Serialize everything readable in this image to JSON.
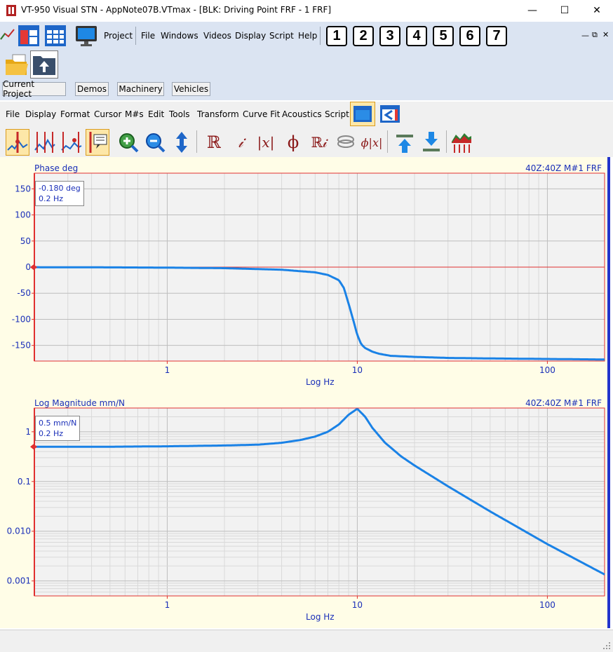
{
  "window": {
    "title": "VT-950 Visual STN - AppNote07B.VTmax - [BLK: Driving Point FRF - 1 FRF]",
    "controls": [
      "—",
      "☐",
      "✕"
    ]
  },
  "main_menu": {
    "items": [
      "Project",
      "File",
      "Windows",
      "Videos",
      "Display",
      "Script",
      "Help"
    ],
    "number_buttons": [
      "1",
      "2",
      "3",
      "4",
      "5",
      "6",
      "7"
    ]
  },
  "project_tabs": [
    "Current Project",
    "Demos",
    "Machinery",
    "Vehicles"
  ],
  "window_menu": [
    "File",
    "Display",
    "Format",
    "Cursor",
    "M#s",
    "Edit",
    "Tools",
    "Transform",
    "Curve Fit",
    "Acoustics",
    "Script"
  ],
  "toolbar_glyphs": {
    "real": "ℝ",
    "imag": "𝒾",
    "mag": "|x|",
    "phase": "ϕ",
    "real_imag": "ℝ𝒾",
    "phase_mag": "ϕ|x|"
  },
  "phase_graph": {
    "title": "Phase deg",
    "trace_label": "40Z:40Z M#1 FRF",
    "cursor_value": "-0.180 deg",
    "cursor_freq": "0.2 Hz",
    "xlabel": "Log Hz"
  },
  "mag_graph": {
    "title": "Log Magnitude mm/N",
    "trace_label": "40Z:40Z M#1 FRF",
    "cursor_value": "0.5 mm/N",
    "cursor_freq": "0.2 Hz",
    "xlabel": "Log Hz"
  },
  "colors": {
    "trace": "#1a82e6",
    "axis_text": "#1a2fb8",
    "frame": "#e03030",
    "background": "#fffde7"
  },
  "chart_data": [
    {
      "type": "line",
      "title": "Phase deg",
      "xlabel": "Log Hz",
      "ylabel": "",
      "xscale": "log",
      "xlim": [
        0.2,
        200
      ],
      "ylim": [
        -180,
        180
      ],
      "xticks": [
        "1",
        "10",
        "100"
      ],
      "yticks": [
        "150",
        "100",
        "50",
        "0",
        "-50",
        "-100",
        "-150"
      ],
      "legend": "40Z:40Z M#1 FRF",
      "series": [
        {
          "name": "40Z:40Z M#1 FRF",
          "x": [
            0.2,
            0.5,
            1,
            2,
            4,
            6,
            7,
            8,
            8.5,
            9,
            9.5,
            10,
            10.5,
            11,
            12,
            13,
            15,
            20,
            30,
            50,
            100,
            200
          ],
          "values": [
            -0.18,
            -0.5,
            -1,
            -2,
            -5,
            -10,
            -15,
            -25,
            -40,
            -70,
            -100,
            -130,
            -148,
            -155,
            -162,
            -166,
            -170,
            -172,
            -174,
            -175,
            -176,
            -177
          ]
        }
      ]
    },
    {
      "type": "line",
      "title": "Log Magnitude mm/N",
      "xlabel": "Log Hz",
      "ylabel": "",
      "xscale": "log",
      "yscale": "log",
      "xlim": [
        0.2,
        200
      ],
      "ylim": [
        0.0005,
        3
      ],
      "xticks": [
        "1",
        "10",
        "100"
      ],
      "yticks": [
        "1",
        "0.1",
        "0.010",
        "0.001"
      ],
      "legend": "40Z:40Z M#1 FRF",
      "series": [
        {
          "name": "40Z:40Z M#1 FRF",
          "x": [
            0.2,
            0.5,
            1,
            2,
            3,
            4,
            5,
            6,
            7,
            8,
            9,
            10,
            11,
            12,
            14,
            17,
            20,
            30,
            50,
            100,
            200
          ],
          "values": [
            0.5,
            0.5,
            0.51,
            0.53,
            0.55,
            0.6,
            0.68,
            0.8,
            1.0,
            1.4,
            2.2,
            2.9,
            2.0,
            1.2,
            0.6,
            0.32,
            0.21,
            0.08,
            0.025,
            0.0055,
            0.00135
          ]
        }
      ]
    }
  ]
}
